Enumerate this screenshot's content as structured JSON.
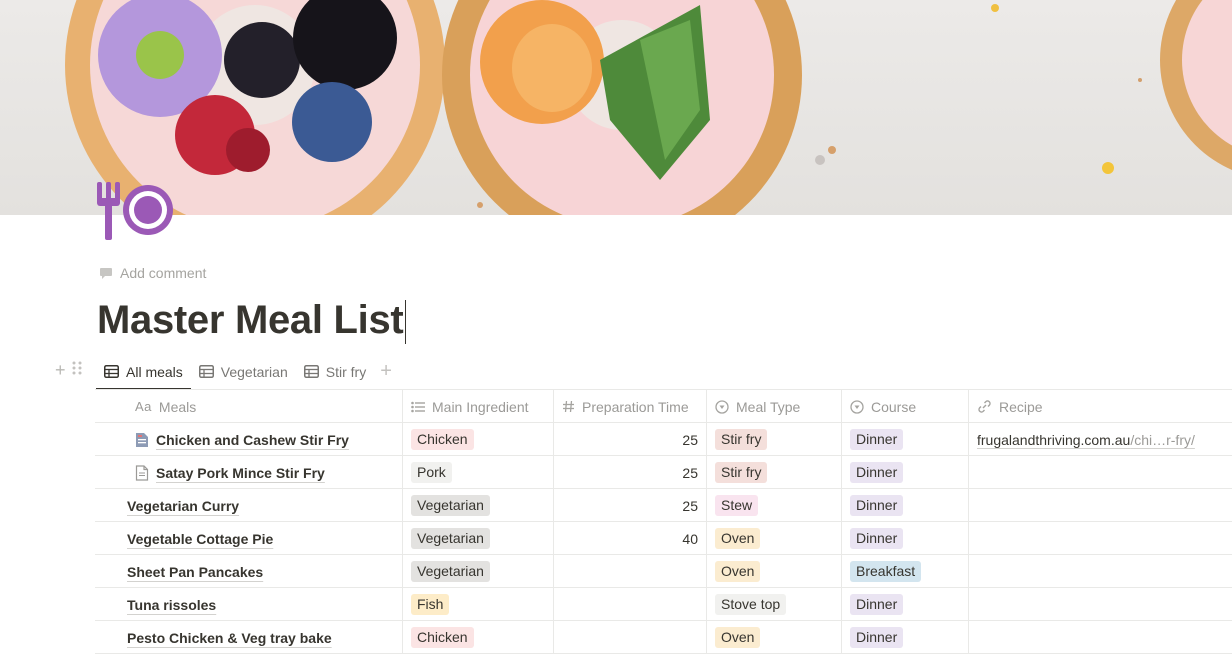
{
  "page": {
    "icon": "fork-and-plate-icon",
    "add_comment": "Add comment",
    "title": "Master Meal List"
  },
  "views": [
    {
      "label": "All meals",
      "icon": "table-icon",
      "active": true
    },
    {
      "label": "Vegetarian",
      "icon": "table-icon",
      "active": false
    },
    {
      "label": "Stir fry",
      "icon": "table-icon",
      "active": false
    }
  ],
  "columns": {
    "meals": {
      "label": "Meals",
      "icon": "Aa"
    },
    "main_ingredient": {
      "label": "Main Ingredient",
      "icon": "list-icon"
    },
    "prep_time": {
      "label": "Preparation Time",
      "icon": "hash-icon"
    },
    "meal_type": {
      "label": "Meal Type",
      "icon": "select-icon"
    },
    "course": {
      "label": "Course",
      "icon": "select-icon"
    },
    "recipe": {
      "label": "Recipe",
      "icon": "link-icon"
    }
  },
  "colors": {
    "chicken": "#fbe4e4",
    "pork": "#f1f1ef",
    "vegetarian": "#e3e2e0",
    "fish": "#fdecc8",
    "stir_fry": "#f4dfdb",
    "stew": "#f9e4ef",
    "oven": "#fbecd0",
    "stove_top": "#f1f1ef",
    "dinner": "#eae4f2",
    "breakfast": "#d3e5ef"
  },
  "rows": [
    {
      "meal": "Chicken and Cashew Stir Fry",
      "icon": "doc-filled-icon",
      "ingredient": "Chicken",
      "ing_color": "#fbe4e4",
      "prep": "25",
      "type": "Stir fry",
      "type_color": "#f4dfdb",
      "course": "Dinner",
      "course_color": "#eae4f2",
      "recipe_main": "frugalandthriving.com.au",
      "recipe_dim": "/chi…r-fry/"
    },
    {
      "meal": "Satay Pork Mince Stir Fry",
      "icon": "doc-outline-icon",
      "ingredient": "Pork",
      "ing_color": "#f1f1ef",
      "prep": "25",
      "type": "Stir fry",
      "type_color": "#f4dfdb",
      "course": "Dinner",
      "course_color": "#eae4f2",
      "recipe_main": "",
      "recipe_dim": ""
    },
    {
      "meal": "Vegetarian Curry",
      "icon": "",
      "ingredient": "Vegetarian",
      "ing_color": "#e3e2e0",
      "prep": "25",
      "type": "Stew",
      "type_color": "#f9e4ef",
      "course": "Dinner",
      "course_color": "#eae4f2",
      "recipe_main": "",
      "recipe_dim": ""
    },
    {
      "meal": "Vegetable Cottage Pie",
      "icon": "",
      "ingredient": "Vegetarian",
      "ing_color": "#e3e2e0",
      "prep": "40",
      "type": "Oven",
      "type_color": "#fbecd0",
      "course": "Dinner",
      "course_color": "#eae4f2",
      "recipe_main": "",
      "recipe_dim": ""
    },
    {
      "meal": "Sheet Pan Pancakes",
      "icon": "",
      "ingredient": "Vegetarian",
      "ing_color": "#e3e2e0",
      "prep": "",
      "type": "Oven",
      "type_color": "#fbecd0",
      "course": "Breakfast",
      "course_color": "#d3e5ef",
      "recipe_main": "",
      "recipe_dim": ""
    },
    {
      "meal": "Tuna rissoles",
      "icon": "",
      "ingredient": "Fish",
      "ing_color": "#fdecc8",
      "prep": "",
      "type": "Stove top",
      "type_color": "#f1f1ef",
      "course": "Dinner",
      "course_color": "#eae4f2",
      "recipe_main": "",
      "recipe_dim": ""
    },
    {
      "meal": "Pesto Chicken & Veg tray bake",
      "icon": "",
      "ingredient": "Chicken",
      "ing_color": "#fbe4e4",
      "prep": "",
      "type": "Oven",
      "type_color": "#fbecd0",
      "course": "Dinner",
      "course_color": "#eae4f2",
      "recipe_main": "",
      "recipe_dim": ""
    }
  ]
}
